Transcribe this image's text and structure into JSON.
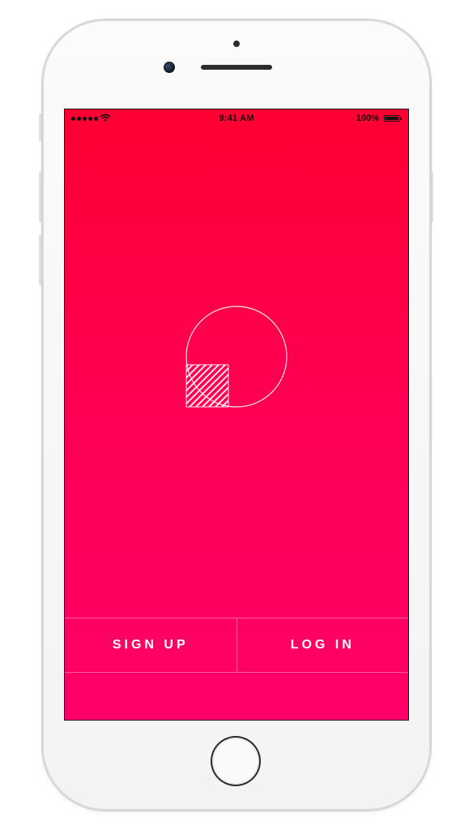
{
  "status_bar": {
    "time": "9:41 AM",
    "battery_percent": "100%",
    "signal_bars": 5,
    "battery_level": 1.0
  },
  "logo": {
    "name": "app-logo"
  },
  "actions": {
    "signup_label": "SIGN UP",
    "login_label": "LOG IN"
  },
  "colors": {
    "gradient_top": "#ff0033",
    "gradient_bottom": "#ff0068",
    "button_text": "#ffffff"
  }
}
